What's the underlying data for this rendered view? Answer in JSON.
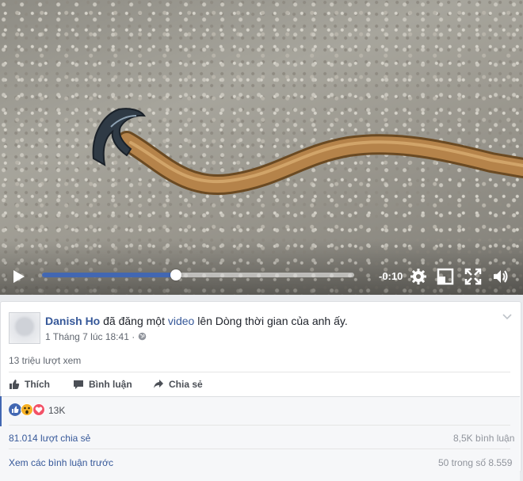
{
  "video": {
    "time_remaining": "-0:10",
    "progress_fraction": 0.43
  },
  "post": {
    "author": "Danish Ho",
    "action_text": " đã đăng một ",
    "video_link": "video",
    "suffix_text": " lên Dòng thời gian của anh ấy.",
    "timestamp": "1 Tháng 7 lúc 18:41",
    "separator": " · ",
    "views": "13 triệu lượt xem"
  },
  "actions": {
    "like": "Thích",
    "comment": "Bình luận",
    "share": "Chia sẻ"
  },
  "stats": {
    "reactions_count": "13K",
    "shares": "81.014 lượt chia sẻ",
    "comments": "8,5K bình luận",
    "view_previous": "Xem các bình luận trước",
    "comment_range": "50 trong số 8.559"
  },
  "colors": {
    "fb_blue": "#4267b2",
    "link": "#365899",
    "love": "#f25268",
    "wow": "#f7b125"
  },
  "icons": [
    "play-icon",
    "settings-icon",
    "theater-mode-icon",
    "fullscreen-icon",
    "volume-icon",
    "globe-icon",
    "chevron-down-icon",
    "like-icon",
    "comment-icon",
    "share-icon",
    "like-reaction-icon",
    "wow-reaction-icon",
    "love-reaction-icon"
  ]
}
